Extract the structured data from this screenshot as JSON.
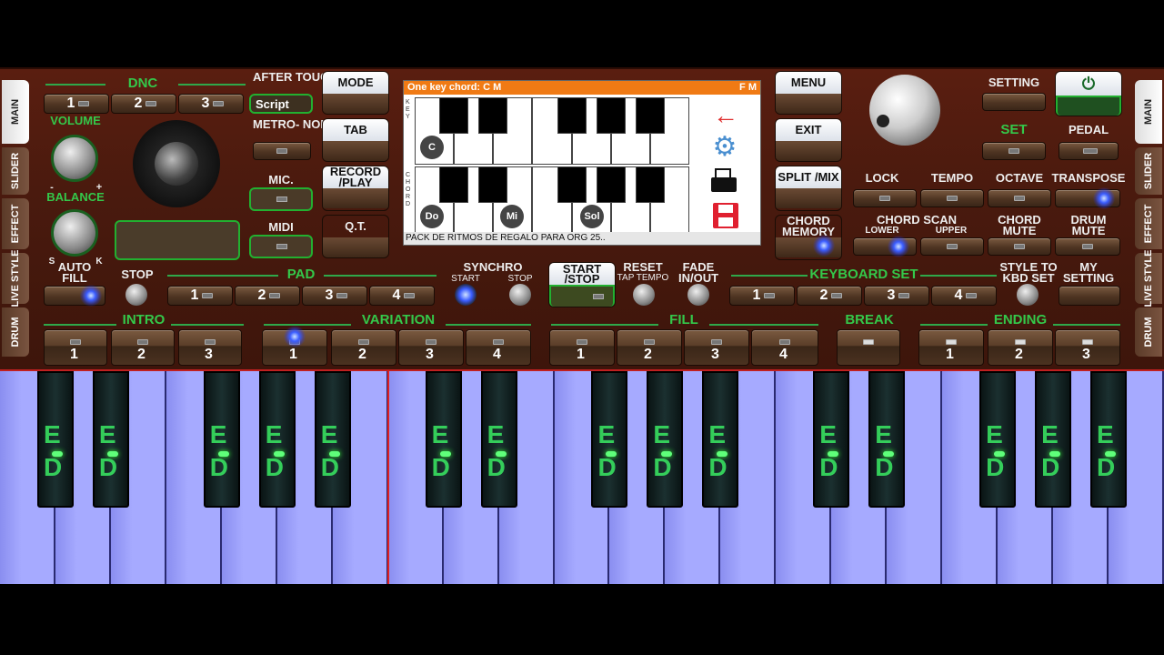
{
  "side_tabs_left": [
    "MAIN",
    "SLIDER",
    "EFFECT",
    "LIVE STYLE",
    "DRUM"
  ],
  "side_tabs_right": [
    "MAIN",
    "SLIDER",
    "EFFECT",
    "LIVE STYLE",
    "DRUM"
  ],
  "dnc": {
    "title": "DNC",
    "buttons": [
      "1",
      "2",
      "3"
    ],
    "script_label": "Script"
  },
  "after_touch": "AFTER TOUCH",
  "metronome": "METRO- NOME",
  "mic": "MIC.",
  "midi": "MIDI",
  "volume": "VOLUME",
  "balance": "BALANCE",
  "balance_s": "S",
  "balance_k": "K",
  "minus": "-",
  "plus": "+",
  "menu_left": [
    "MODE",
    "TAB",
    "RECORD /PLAY",
    "Q.T."
  ],
  "menu_right": [
    "MENU",
    "EXIT",
    "SPLIT /MIX",
    "CHORD MEMORY"
  ],
  "screen": {
    "header": "One key chord: C M",
    "mode": "F M",
    "key_label": "KEY",
    "chord_label": "CHORD",
    "key_note": "C",
    "chord_notes": [
      "Do",
      "Mi",
      "Sol"
    ],
    "footer": "PACK DE RITMOS DE REGALO PARA ORG 25.."
  },
  "top_right": {
    "setting": "SETTING",
    "set": "SET",
    "pedal": "PEDAL",
    "lock": "LOCK",
    "tempo": "TEMPO",
    "octave": "OCTAVE",
    "transpose": "TRANSPOSE",
    "chord_scan": "CHORD SCAN",
    "lower": "LOWER",
    "upper": "UPPER",
    "chord_mute": "CHORD MUTE",
    "drum_mute": "DRUM MUTE"
  },
  "row3": {
    "auto_fill": "AUTO FILL",
    "stop": "STOP",
    "pad": "PAD",
    "pad_buttons": [
      "1",
      "2",
      "3",
      "4"
    ],
    "synchro": "SYNCHRO",
    "synchro_start": "START",
    "synchro_stop": "STOP",
    "start_stop": "START /STOP",
    "reset": "RESET",
    "tap_tempo": "TAP TEMPO",
    "fade": "FADE IN/OUT",
    "keyboard_set": "KEYBOARD SET",
    "kbd_buttons": [
      "1",
      "2",
      "3",
      "4"
    ],
    "style_to_kbd": "STYLE TO KBD SET",
    "my_setting": "MY SETTING"
  },
  "row4": {
    "intro": "INTRO",
    "intro_buttons": [
      "1",
      "2",
      "3"
    ],
    "variation": "VARIATION",
    "variation_buttons": [
      "1",
      "2",
      "3",
      "4"
    ],
    "fill": "FILL",
    "fill_buttons": [
      "1",
      "2",
      "3",
      "4"
    ],
    "break": "BREAK",
    "ending": "ENDING",
    "ending_buttons": [
      "1",
      "2",
      "3"
    ]
  },
  "keyboard": {
    "black_key_labels": [
      "E",
      "D"
    ]
  },
  "colors": {
    "led": "#3a5cff",
    "green": "#34c84a",
    "screen_header": "#f07a14",
    "keys": "#a6aaff"
  }
}
